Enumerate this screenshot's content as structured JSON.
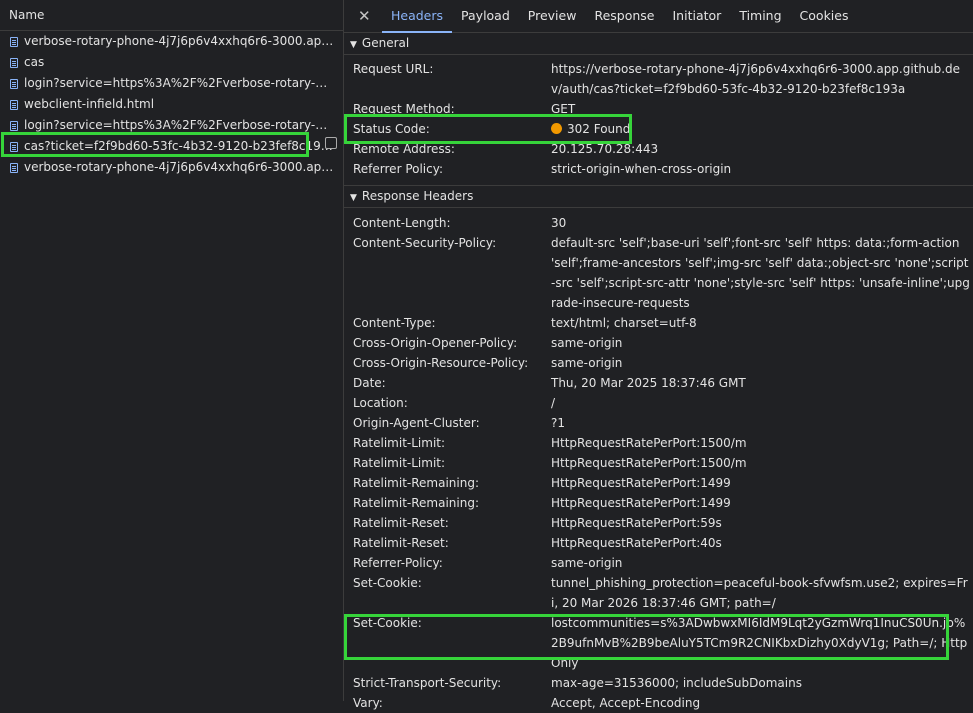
{
  "left": {
    "header": "Name",
    "requests": [
      {
        "name": "verbose-rotary-phone-4j7j6p6v4xxhq6r6-3000.app.githu..."
      },
      {
        "name": "cas"
      },
      {
        "name": "login?service=https%3A%2F%2Fverbose-rotary-phone-4j..."
      },
      {
        "name": "webclient-infield.html"
      },
      {
        "name": "login?service=https%3A%2F%2Fverbose-rotary-phone-4j..."
      },
      {
        "name": "cas?ticket=f2f9bd60-53fc-4b32-9120-b23fef8c193a"
      },
      {
        "name": "verbose-rotary-phone-4j7j6p6v4xxhq6r6-3000.app.githu..."
      }
    ]
  },
  "tabs": [
    "Headers",
    "Payload",
    "Preview",
    "Response",
    "Initiator",
    "Timing",
    "Cookies"
  ],
  "general": {
    "title": "General",
    "rows": [
      {
        "k": "Request URL:",
        "v": "https://verbose-rotary-phone-4j7j6p6v4xxhq6r6-3000.app.github.dev/auth/cas?ticket=f2f9bd60-53fc-4b32-9120-b23fef8c193a"
      },
      {
        "k": "Request Method:",
        "v": "GET"
      },
      {
        "k": "Status Code:",
        "v": "302 Found"
      },
      {
        "k": "Remote Address:",
        "v": "20.125.70.28:443"
      },
      {
        "k": "Referrer Policy:",
        "v": "strict-origin-when-cross-origin"
      }
    ]
  },
  "response": {
    "title": "Response Headers",
    "rows": [
      {
        "k": "Content-Length:",
        "v": "30"
      },
      {
        "k": "Content-Security-Policy:",
        "v": "default-src 'self';base-uri 'self';font-src 'self' https: data:;form-action 'self';frame-ancestors 'self';img-src 'self' data:;object-src 'none';script-src 'self';script-src-attr 'none';style-src 'self' https: 'unsafe-inline';upgrade-insecure-requests"
      },
      {
        "k": "Content-Type:",
        "v": "text/html; charset=utf-8"
      },
      {
        "k": "Cross-Origin-Opener-Policy:",
        "v": "same-origin"
      },
      {
        "k": "Cross-Origin-Resource-Policy:",
        "v": "same-origin"
      },
      {
        "k": "Date:",
        "v": "Thu, 20 Mar 2025 18:37:46 GMT"
      },
      {
        "k": "Location:",
        "v": "/"
      },
      {
        "k": "Origin-Agent-Cluster:",
        "v": "?1"
      },
      {
        "k": "Ratelimit-Limit:",
        "v": "HttpRequestRatePerPort:1500/m"
      },
      {
        "k": "Ratelimit-Limit:",
        "v": "HttpRequestRatePerPort:1500/m"
      },
      {
        "k": "Ratelimit-Remaining:",
        "v": "HttpRequestRatePerPort:1499"
      },
      {
        "k": "Ratelimit-Remaining:",
        "v": "HttpRequestRatePerPort:1499"
      },
      {
        "k": "Ratelimit-Reset:",
        "v": "HttpRequestRatePerPort:59s"
      },
      {
        "k": "Ratelimit-Reset:",
        "v": "HttpRequestRatePerPort:40s"
      },
      {
        "k": "Referrer-Policy:",
        "v": "same-origin"
      },
      {
        "k": "Set-Cookie:",
        "v": "tunnel_phishing_protection=peaceful-book-sfvwfsm.use2; expires=Fri, 20 Mar 2026 18:37:46 GMT; path=/"
      },
      {
        "k": "Set-Cookie:",
        "v": "lostcommunities=s%3ADwbwxMI6IdM9Lqt2yGzmWrq1InuCS0Un.jp%2B9ufnMvB%2B9beAluY5TCm9R2CNIKbxDizhy0XdyV1g; Path=/; HttpOnly"
      },
      {
        "k": "Strict-Transport-Security:",
        "v": "max-age=31536000; includeSubDomains"
      },
      {
        "k": "Vary:",
        "v": "Accept, Accept-Encoding"
      }
    ]
  },
  "colors": {
    "highlight": "#36d43a",
    "status_dot": "#f29900",
    "accent": "#8ab4f8"
  }
}
